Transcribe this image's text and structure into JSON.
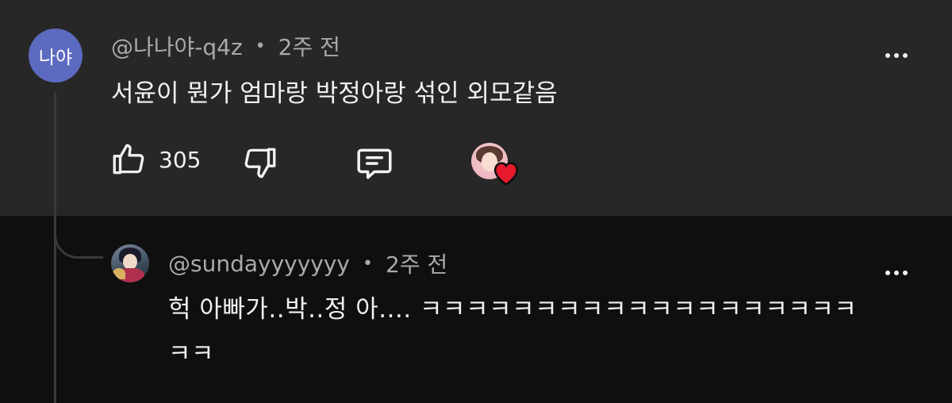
{
  "comment": {
    "avatar_text": "나야",
    "author": "@나나야-q4z",
    "separator": "•",
    "time": "2주 전",
    "text": "서윤이 뭔가 엄마랑 박정아랑 섞인 외모같음",
    "like_count": "305",
    "icons": {
      "like": "thumbs-up-icon",
      "dislike": "thumbs-down-icon",
      "reply": "comment-reply-icon",
      "more": "more-options-icon",
      "creator_heart": "creator-heart-icon"
    },
    "colors": {
      "avatar_bg": "#5c6bc0",
      "heart": "#e8192c",
      "background": "#272727"
    }
  },
  "reply": {
    "author": "@sundayyyyyyy",
    "separator": "•",
    "time": "2주 전",
    "text_line1": "헉 아빠가..박..정 아.... ㅋㅋㅋㅋㅋㅋㅋㅋㅋㅋㅋㅋㅋㅋㅋㅋㅋㅋㅋ",
    "text_line2": "ㅋㅋ",
    "colors": {
      "background": "#0f0f0f"
    }
  }
}
